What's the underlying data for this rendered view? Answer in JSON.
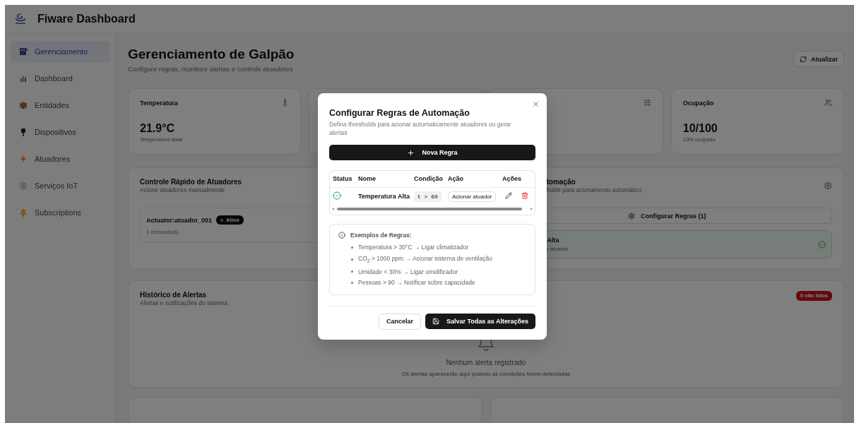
{
  "app": {
    "title": "Fiware Dashboard"
  },
  "sidebar": {
    "items": [
      {
        "label": "Gerenciamento",
        "selected": true
      },
      {
        "label": "Dashboard",
        "selected": false
      },
      {
        "label": "Entidades",
        "selected": false
      },
      {
        "label": "Dispositivos",
        "selected": false
      },
      {
        "label": "Atuadores",
        "selected": false
      },
      {
        "label": "Serviços IoT",
        "selected": false
      },
      {
        "label": "Subscriptions",
        "selected": false
      }
    ]
  },
  "page": {
    "title": "Gerenciamento de Galpão",
    "subtitle": "Configure regras, monitore alertas e controle atuadores",
    "refresh_button": "Atualizar"
  },
  "stat_cards": [
    {
      "kind": "metric",
      "title": "Temperatura",
      "value": "21.9°C",
      "caption": "Temperatura atual"
    },
    {
      "kind": "covered"
    },
    {
      "kind": "covered_icon"
    },
    {
      "kind": "metric",
      "title": "Ocupação",
      "value": "10/100",
      "caption": "10% ocupado"
    }
  ],
  "actuator_panel": {
    "title": "Controle Rápido de Atuadores",
    "subtitle": "Acione atuadores manualmente",
    "actuators": [
      {
        "name": "Actuator:atuador_001",
        "status": "Ativo",
        "active": true,
        "commands": "1 comando(s)"
      }
    ]
  },
  "rules_panel": {
    "title_fragment": "tomação",
    "subtitle_fragment": "holds para acionamento automático",
    "configure_button": "Configurar Regras (1)",
    "rules": [
      {
        "name_fragment": "Alta",
        "action_fragment": "r atuador",
        "enabled": true
      }
    ]
  },
  "alerts_panel": {
    "title": "Histórico de Alertas",
    "subtitle": "Alertas e notificações do sistema",
    "unread_badge": "0 não lidos",
    "empty_title": "Nenhum alerta registrado",
    "empty_text": "Os alertas aparecerão aqui quando as condições forem detectadas"
  },
  "dialog": {
    "title": "Configurar Regras de Automação",
    "description": "Defina thresholds para acionar automaticamente atuadores ou gerar alertas",
    "new_rule_button": "Nova Regra",
    "table": {
      "columns": [
        "Status",
        "Nome",
        "Condição",
        "Ação",
        "Ações"
      ],
      "rows": [
        {
          "enabled": true,
          "name": "Temperatura Alta",
          "condition": "t > 60",
          "action": "Acionar atuador"
        }
      ]
    },
    "examples": {
      "title": "Exemplos de Regras:",
      "items": [
        "Temperatura > 30°C → Ligar climatizador",
        "CO$_{2}$ > 1000 ppm → Acionar sistema de ventilação",
        "Umidade < 30% → Ligar umidificador",
        "Pessoas > 90 → Notificar sobre capacidade"
      ]
    },
    "cancel_button": "Cancelar",
    "save_button": "Salvar Todas as Alterações"
  }
}
